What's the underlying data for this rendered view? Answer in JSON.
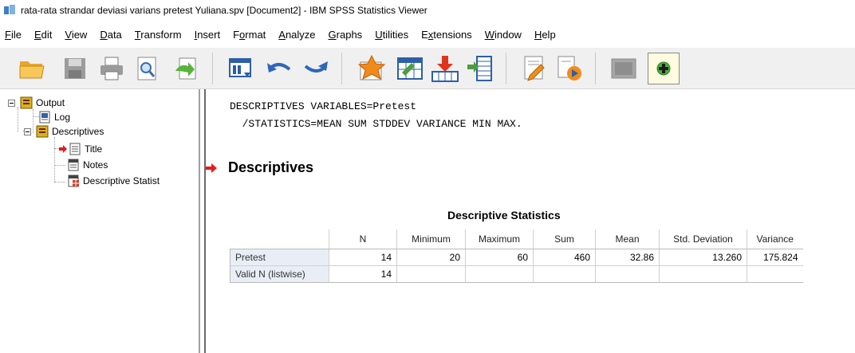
{
  "window": {
    "title": "rata-rata strandar deviasi varians pretest Yuliana.spv [Document2] - IBM SPSS Statistics Viewer"
  },
  "menu": [
    {
      "label": "File",
      "ul": "F",
      "rest": "ile"
    },
    {
      "label": "Edit",
      "ul": "E",
      "rest": "dit"
    },
    {
      "label": "View",
      "ul": "V",
      "rest": "iew"
    },
    {
      "label": "Data",
      "ul": "D",
      "rest": "ata"
    },
    {
      "label": "Transform",
      "ul": "T",
      "rest": "ransform"
    },
    {
      "label": "Insert",
      "ul": "I",
      "rest": "nsert"
    },
    {
      "label": "Format",
      "ul": "o",
      "pre": "F",
      "rest": "rmat"
    },
    {
      "label": "Analyze",
      "ul": "A",
      "rest": "nalyze"
    },
    {
      "label": "Graphs",
      "ul": "G",
      "rest": "raphs"
    },
    {
      "label": "Utilities",
      "ul": "U",
      "rest": "tilities"
    },
    {
      "label": "Extensions",
      "ul": "x",
      "pre": "E",
      "rest": "tensions"
    },
    {
      "label": "Window",
      "ul": "W",
      "rest": "indow"
    },
    {
      "label": "Help",
      "ul": "H",
      "rest": "elp"
    }
  ],
  "toolbar": {
    "icons": [
      "open-folder-icon",
      "save-icon",
      "print-icon",
      "print-preview-icon",
      "export-icon",
      "recall-dialog-icon",
      "undo-icon",
      "redo-icon",
      "goto-data-icon",
      "goto-case-icon",
      "goto-variable-icon",
      "variables-icon",
      "insert-output-icon",
      "run-script-icon",
      "designate-window-icon",
      "add-item-icon"
    ]
  },
  "tree": {
    "output": "Output",
    "log": "Log",
    "descriptives": "Descriptives",
    "title": "Title",
    "notes": "Notes",
    "descriptive_stats": "Descriptive Statist"
  },
  "syntax": {
    "line1": "DESCRIPTIVES VARIABLES=Pretest",
    "line2": "  /STATISTICS=MEAN SUM STDDEV VARIANCE MIN MAX."
  },
  "output": {
    "heading": "Descriptives",
    "table_title": "Descriptive Statistics",
    "columns": [
      "N",
      "Minimum",
      "Maximum",
      "Sum",
      "Mean",
      "Std. Deviation",
      "Variance"
    ],
    "rows": [
      {
        "label": "Pretest",
        "cells": [
          "14",
          "20",
          "60",
          "460",
          "32.86",
          "13.260",
          "175.824"
        ]
      },
      {
        "label": "Valid N (listwise)",
        "cells": [
          "14",
          "",
          "",
          "",
          "",
          "",
          ""
        ]
      }
    ]
  },
  "colors": {
    "accent_arrow": "#e8191d",
    "row_label_bg": "#e9eef6"
  }
}
